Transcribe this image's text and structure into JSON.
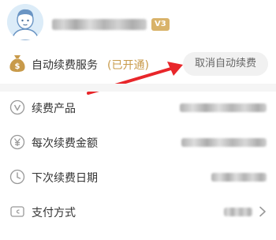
{
  "header": {
    "vip_badge": "V3"
  },
  "service": {
    "label": "自动续费服务",
    "status": "(已开通)",
    "cancel_label": "取消自动续费",
    "icon": "money-bag-icon"
  },
  "rows": [
    {
      "label": "续费产品",
      "icon": "v-circle-icon"
    },
    {
      "label": "每次续费金额",
      "icon": "yen-circle-icon"
    },
    {
      "label": "下次续费日期",
      "icon": "clock-icon"
    },
    {
      "label": "支付方式",
      "icon": "wallet-icon"
    }
  ],
  "colors": {
    "accent_gold": "#c89a4a",
    "badge_gold": "#d9b36a",
    "arrow_red": "#e8262a",
    "cancel_bg": "#f1f1f1",
    "divider": "#f5f5f5"
  }
}
